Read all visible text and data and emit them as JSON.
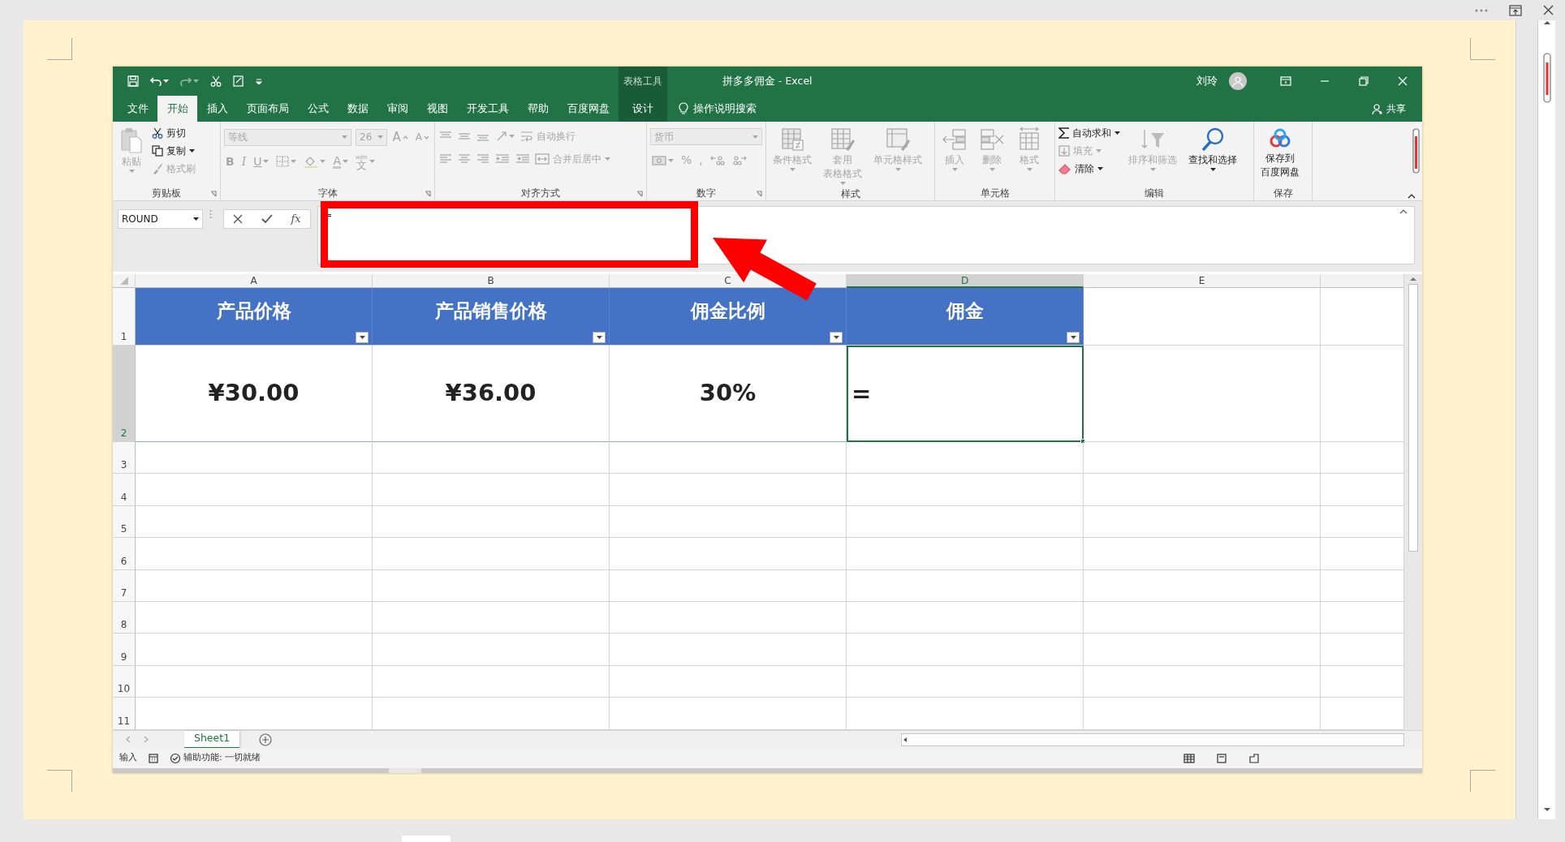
{
  "window": {
    "title": "拼多多佣金 - Excel",
    "context_label": "表格工具",
    "user": "刘玲"
  },
  "tabs": [
    {
      "label": "文件",
      "selected": false,
      "kind": "normal"
    },
    {
      "label": "开始",
      "selected": true,
      "kind": "normal"
    },
    {
      "label": "插入",
      "selected": false,
      "kind": "normal"
    },
    {
      "label": "页面布局",
      "selected": false,
      "kind": "normal"
    },
    {
      "label": "公式",
      "selected": false,
      "kind": "normal"
    },
    {
      "label": "数据",
      "selected": false,
      "kind": "normal"
    },
    {
      "label": "审阅",
      "selected": false,
      "kind": "normal"
    },
    {
      "label": "视图",
      "selected": false,
      "kind": "normal"
    },
    {
      "label": "开发工具",
      "selected": false,
      "kind": "normal"
    },
    {
      "label": "帮助",
      "selected": false,
      "kind": "normal"
    },
    {
      "label": "百度网盘",
      "selected": false,
      "kind": "normal"
    },
    {
      "label": "设计",
      "selected": false,
      "kind": "contextual"
    }
  ],
  "tell_me": "操作说明搜索",
  "share": "共享",
  "ribbon": [
    {
      "title": "剪贴板",
      "columns": [
        [
          {
            "label": "粘贴",
            "kind": "large",
            "disabled": true
          }
        ],
        [
          {
            "label": "剪切",
            "kind": "small",
            "disabled": false
          },
          {
            "label": "复制",
            "kind": "small",
            "disabled": false
          },
          {
            "label": "格式刷",
            "kind": "small",
            "disabled": true
          }
        ]
      ]
    },
    {
      "title": "字体",
      "bands": [
        [
          {
            "label": "等线",
            "kind": "combo",
            "disabled": true
          },
          {
            "label": "26",
            "kind": "combo",
            "disabled": true
          },
          {
            "label": "A",
            "kind": "glyph",
            "disabled": true
          },
          {
            "label": "A",
            "kind": "glyph",
            "disabled": true
          }
        ],
        [
          {
            "label": "B",
            "kind": "glyph",
            "disabled": true
          },
          {
            "label": "I",
            "kind": "glyph",
            "disabled": true
          },
          {
            "label": "U",
            "kind": "glyph",
            "disabled": true
          },
          {
            "kind": "icon",
            "disabled": true
          },
          {
            "kind": "icon",
            "disabled": true
          },
          {
            "label": "A",
            "kind": "glyph",
            "disabled": true
          },
          {
            "label": "文",
            "ruby": "wén",
            "kind": "glyph",
            "disabled": true
          }
        ]
      ]
    },
    {
      "title": "对齐方式",
      "bands": [
        [
          {
            "kind": "icon",
            "disabled": true
          },
          {
            "kind": "icon",
            "disabled": true
          },
          {
            "kind": "icon",
            "disabled": true
          },
          {
            "kind": "icon",
            "disabled": true
          },
          {
            "label": "自动换行",
            "kind": "small",
            "disabled": true
          }
        ],
        [
          {
            "kind": "icon",
            "disabled": true
          },
          {
            "kind": "icon",
            "disabled": true
          },
          {
            "kind": "icon",
            "disabled": true
          },
          {
            "kind": "icon",
            "disabled": true
          },
          {
            "kind": "icon",
            "disabled": true
          },
          {
            "label": "合并后居中",
            "kind": "small",
            "disabled": true
          }
        ]
      ]
    },
    {
      "title": "数字",
      "bands": [
        [
          {
            "label": "货币",
            "kind": "combo",
            "disabled": true
          }
        ],
        [
          {
            "kind": "icon",
            "disabled": true
          },
          {
            "label": "%",
            "kind": "glyph",
            "disabled": true
          },
          {
            "label": ",",
            "kind": "glyph",
            "disabled": true
          },
          {
            "kind": "icon",
            "disabled": true
          },
          {
            "kind": "icon",
            "disabled": true
          }
        ]
      ]
    },
    {
      "title": "样式",
      "columns": [
        [
          {
            "label": "条件格式",
            "kind": "large",
            "disabled": true
          }
        ],
        [
          {
            "lines": [
              "套用",
              "表格格式"
            ],
            "kind": "large",
            "disabled": true
          }
        ],
        [
          {
            "label": "单元格样式",
            "kind": "large",
            "disabled": true
          }
        ]
      ]
    },
    {
      "title": "单元格",
      "columns": [
        [
          {
            "label": "插入",
            "kind": "large",
            "disabled": true
          }
        ],
        [
          {
            "label": "删除",
            "kind": "large",
            "disabled": true
          }
        ],
        [
          {
            "label": "格式",
            "kind": "large",
            "disabled": true
          }
        ]
      ]
    },
    {
      "title": "编辑",
      "columns": [
        [
          {
            "label": "自动求和",
            "kind": "small",
            "disabled": false
          },
          {
            "label": "填充",
            "kind": "small",
            "disabled": true
          },
          {
            "label": "清除",
            "kind": "small",
            "disabled": false
          }
        ],
        [
          {
            "label": "排序和筛选",
            "kind": "large",
            "disabled": true
          }
        ],
        [
          {
            "label": "查找和选择",
            "kind": "large",
            "disabled": false
          }
        ]
      ]
    },
    {
      "title": "保存",
      "columns": [
        [
          {
            "lines": [
              "保存到",
              "百度网盘"
            ],
            "kind": "large",
            "disabled": false
          }
        ]
      ]
    }
  ],
  "formula_bar": {
    "name_box": "ROUND",
    "function_label": "fx",
    "formula": "="
  },
  "annotations": [
    {
      "kind": "highlight-box"
    },
    {
      "kind": "arrow"
    }
  ],
  "columns": [
    {
      "letter": "A",
      "selected": false
    },
    {
      "letter": "B",
      "selected": false
    },
    {
      "letter": "C",
      "selected": false
    },
    {
      "letter": "D",
      "selected": true
    },
    {
      "letter": "E",
      "selected": false
    }
  ],
  "rows": [
    {
      "number": "1",
      "selected": false,
      "cells": [
        {
          "text": "产品价格",
          "kind": "header",
          "active": false
        },
        {
          "text": "产品销售价格",
          "kind": "header",
          "active": false
        },
        {
          "text": "佣金比例",
          "kind": "header",
          "active": false
        },
        {
          "text": "佣金",
          "kind": "header",
          "active": false
        }
      ]
    },
    {
      "number": "2",
      "selected": true,
      "cells": [
        {
          "text": "¥30.00",
          "kind": "value",
          "active": false
        },
        {
          "text": "¥36.00",
          "kind": "value",
          "active": false
        },
        {
          "text": "30%",
          "kind": "value",
          "active": false
        },
        {
          "text": "=",
          "kind": "value",
          "active": true
        }
      ]
    },
    {
      "number": "3",
      "selected": false
    },
    {
      "number": "4",
      "selected": false
    },
    {
      "number": "5",
      "selected": false
    },
    {
      "number": "6",
      "selected": false
    },
    {
      "number": "7",
      "selected": false
    },
    {
      "number": "8",
      "selected": false
    },
    {
      "number": "9",
      "selected": false
    },
    {
      "number": "10",
      "selected": false
    },
    {
      "number": "11",
      "selected": false
    }
  ],
  "sheets": [
    {
      "label": "Sheet1",
      "selected": true
    }
  ],
  "status_bar": {
    "mode": "输入",
    "accessibility": "辅助功能: 一切就绪"
  }
}
